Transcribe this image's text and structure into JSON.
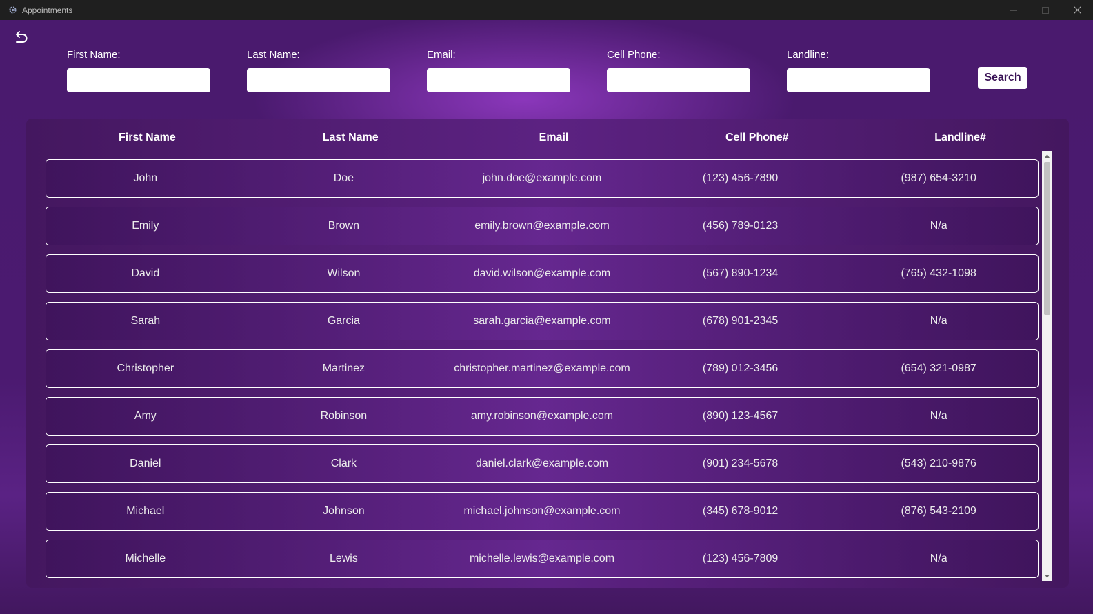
{
  "window": {
    "title": "Appointments"
  },
  "search": {
    "fields": [
      {
        "label": "First Name:",
        "value": ""
      },
      {
        "label": "Last Name:",
        "value": ""
      },
      {
        "label": "Email:",
        "value": ""
      },
      {
        "label": "Cell Phone:",
        "value": ""
      },
      {
        "label": "Landline:",
        "value": ""
      }
    ],
    "button_label": "Search"
  },
  "table": {
    "columns": [
      "First Name",
      "Last Name",
      "Email",
      "Cell Phone#",
      "Landline#"
    ],
    "rows": [
      [
        "John",
        "Doe",
        "john.doe@example.com",
        "(123) 456-7890",
        "(987) 654-3210"
      ],
      [
        "Emily",
        "Brown",
        "emily.brown@example.com",
        "(456) 789-0123",
        "N/a"
      ],
      [
        "David",
        "Wilson",
        "david.wilson@example.com",
        "(567) 890-1234",
        "(765) 432-1098"
      ],
      [
        "Sarah",
        "Garcia",
        "sarah.garcia@example.com",
        "(678) 901-2345",
        "N/a"
      ],
      [
        "Christopher",
        "Martinez",
        "christopher.martinez@example.com",
        "(789) 012-3456",
        "(654) 321-0987"
      ],
      [
        "Amy",
        "Robinson",
        "amy.robinson@example.com",
        "(890) 123-4567",
        "N/a"
      ],
      [
        "Daniel",
        "Clark",
        "daniel.clark@example.com",
        "(901) 234-5678",
        "(543) 210-9876"
      ],
      [
        "Michael",
        "Johnson",
        "michael.johnson@example.com",
        "(345) 678-9012",
        "(876) 543-2109"
      ],
      [
        "Michelle",
        "Lewis",
        "michelle.lewis@example.com",
        "(123) 456-7809",
        "N/a"
      ]
    ]
  },
  "icons": {
    "app": "gear-icon",
    "back": "back-arrow-icon",
    "minimize": "minimize-icon",
    "maximize": "maximize-icon",
    "close": "close-icon"
  },
  "colors": {
    "background": "#4b1a70",
    "accent": "#8a35b8",
    "row_border": "#ffffff",
    "button_text": "#3a1356"
  }
}
